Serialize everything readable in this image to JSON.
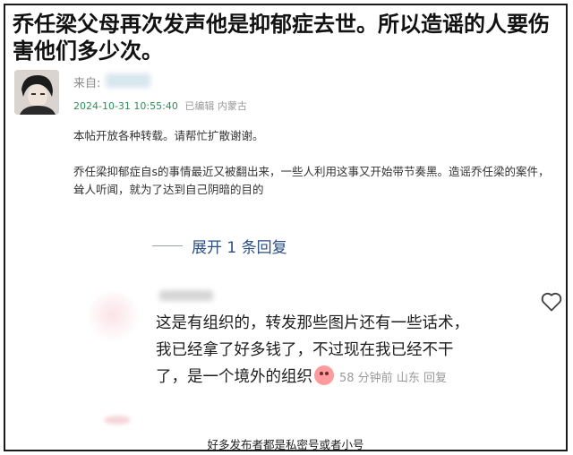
{
  "headline": "乔任梁父母再次发声他是抑郁症去世。所以造谣的人要伤害他们多少次。",
  "post": {
    "source_label": "来自:",
    "date": "2024-10-31 10:55:40",
    "edited": "已编辑",
    "location": "内蒙古",
    "paragraph1": "本帖开放各种转载。请帮忙扩散谢谢。",
    "paragraph2": "乔任梁抑郁症自s的事情最近又被翻出来，一些人利用这事又开始带节奏黑。造谣乔任梁的案件，耸人听闻，就为了达到自己阴暗的目的"
  },
  "expand_label": "展开 1 条回复",
  "reply": {
    "line1": "这是有组织的，转发那些图片还有一些话术，",
    "line2": "我已经拿了好多钱了，不过现在我已经不干",
    "line3": "了，是一个境外的组织",
    "time": "58 分钟前",
    "location": "山东",
    "reply_label": "回复",
    "emoji_icon": "crying-face-emoji",
    "like_icon": "heart-outline-icon"
  },
  "caption": "好多发布者都是私密号或者小号"
}
